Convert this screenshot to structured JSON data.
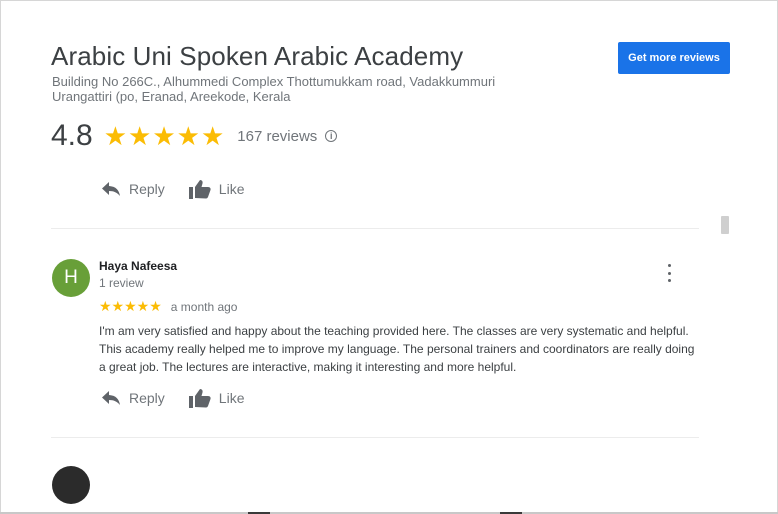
{
  "business": {
    "name": "Arabic Uni Spoken Arabic Academy",
    "address": "Building No 266C., Alhummedi Complex Thottumukkam road, Vadakkummuri Urangattiri (po, Eranad, Areekode, Kerala",
    "get_reviews_label": "Get more reviews",
    "rating": "4.8",
    "stars": "★★★★★",
    "review_count": "167 reviews",
    "info_icon": "i"
  },
  "owner_actions": {
    "reply_label": "Reply",
    "like_label": "Like"
  },
  "review": {
    "avatar_letter": "H",
    "avatar_color": "#689f38",
    "name": "Haya Nafeesa",
    "meta": "1 review",
    "stars": "★★★★★",
    "time": "a month ago",
    "text": "I'm am very satisfied and happy about the teaching provided here. The classes are very systematic and helpful. This academy really helped me to improve my language. The personal trainers and coordinators are really doing a great job. The lectures are interactive, making it interesting and more helpful.",
    "reply_label": "Reply",
    "like_label": "Like"
  },
  "colors": {
    "accent": "#1a73e8",
    "star": "#fbbc04"
  }
}
